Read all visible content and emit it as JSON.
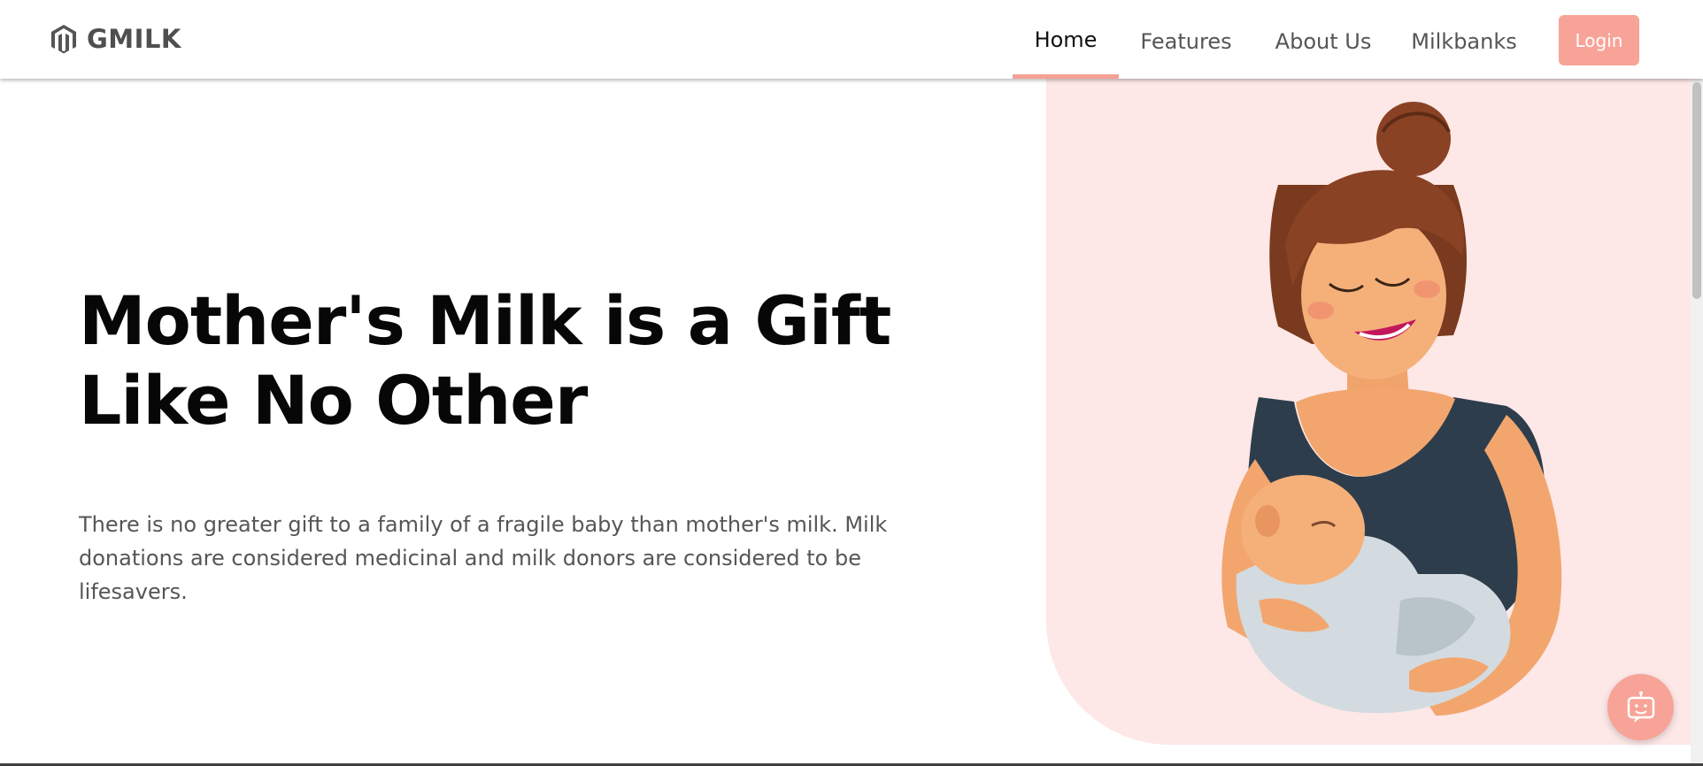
{
  "header": {
    "brand": {
      "name": "GMILK",
      "icon": "magento-style-logo-icon"
    },
    "nav": [
      {
        "label": "Home",
        "active": true
      },
      {
        "label": "Features",
        "active": false
      },
      {
        "label": "About Us",
        "active": false
      },
      {
        "label": "Milkbanks",
        "active": false
      }
    ],
    "login_label": "Login"
  },
  "hero": {
    "title_line1": "Mother's Milk is a Gift",
    "title_line2": "Like No Other",
    "description": "There is no greater gift to a family of a fragile baby than mother's milk. Milk donations are considered medicinal and milk donors are considered to be lifesavers.",
    "illustration": "mother-breastfeeding-baby-illustration"
  },
  "chat_button": {
    "icon": "chat-bot-icon"
  },
  "colors": {
    "accent": "#f8a397",
    "panel_bg": "#fde8e7",
    "title": "#070707",
    "body_text": "#565656",
    "nav_text": "#555555"
  }
}
